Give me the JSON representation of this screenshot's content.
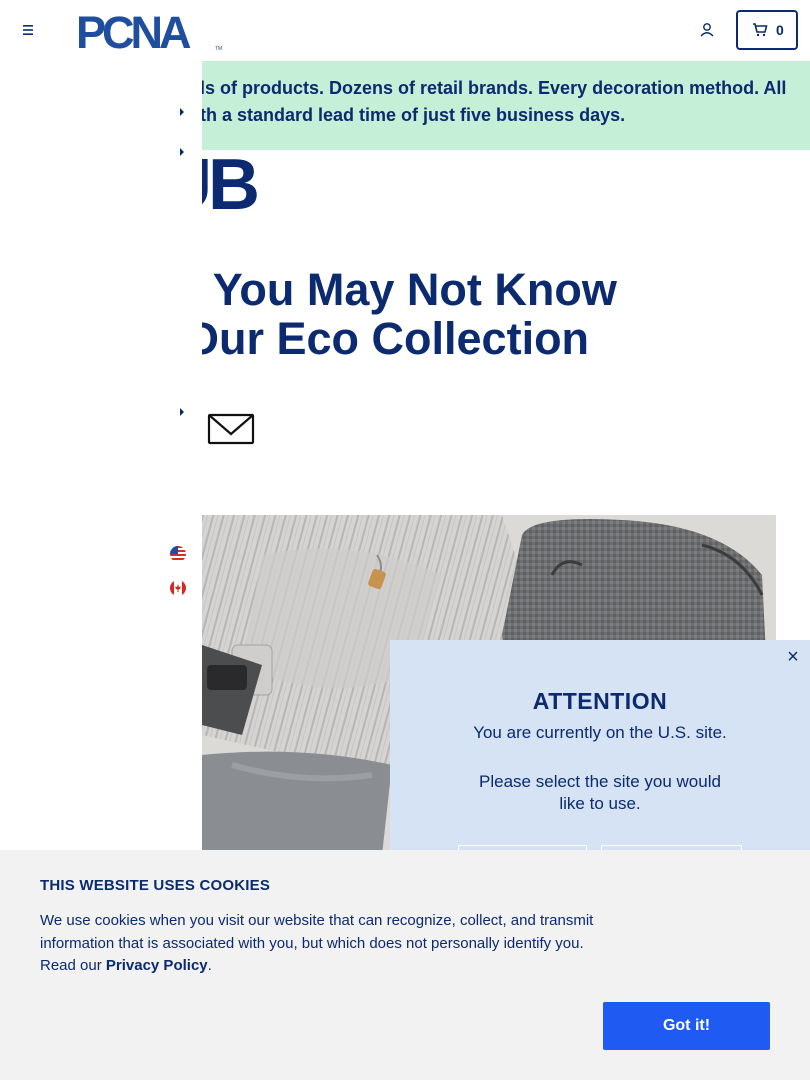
{
  "header": {
    "logo_text": "PCNA",
    "logo_tm": "TM",
    "cart_count": "0"
  },
  "banner": {
    "line1": "ls of products. Dozens of retail brands. Every decoration method. All",
    "line2": "th a standard lead time of just five business days."
  },
  "blog": {
    "word": "UB"
  },
  "article": {
    "title_line1": "s You May Not Know",
    "title_line2": "Our Eco Collection"
  },
  "modal": {
    "close_label": "×",
    "title": "ATTENTION",
    "line1": "You are currently on the U.S. site.",
    "line2": "Please select the site you would like to use."
  },
  "cookie": {
    "title": "THIS WEBSITE USES COOKIES",
    "text": "We use cookies when you visit our website that can recognize, collect, and transmit information that is associated with you, but which does not personally identify you. Read our",
    "link_label": "Privacy Policy",
    "after_link": ".",
    "button_label": "Got it!"
  },
  "colors": {
    "brand_navy": "#0b2a6f",
    "banner_green": "#c5efd7",
    "modal_blue": "#d6e3f4",
    "cookie_bg": "#f2f2f2",
    "accept_button": "#1f5bf2"
  },
  "icons": [
    "hamburger-menu-icon",
    "account-icon",
    "cart-icon",
    "mail-icon",
    "us-flag-icon",
    "canada-flag-icon",
    "close-icon"
  ]
}
